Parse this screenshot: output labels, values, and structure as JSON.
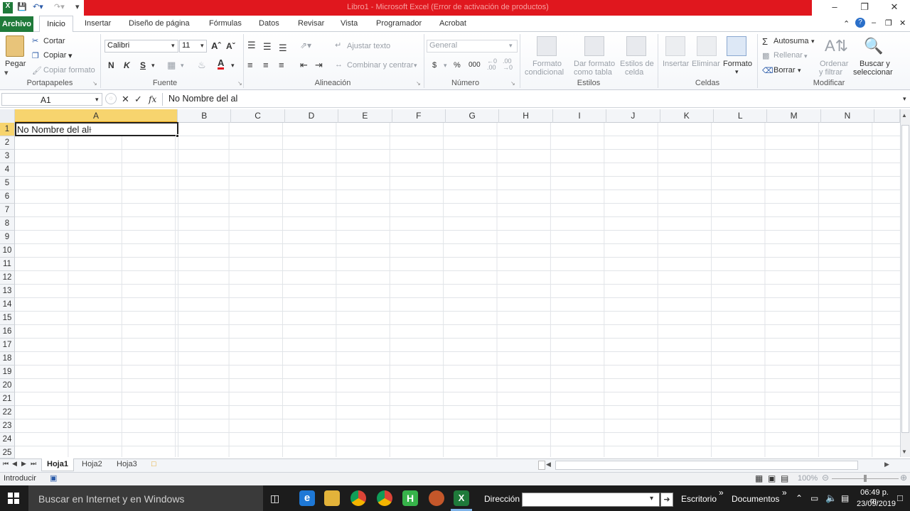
{
  "window": {
    "title": "Libro1 - Microsoft Excel (Error de activación de productos)"
  },
  "tabs": [
    "Archivo",
    "Inicio",
    "Insertar",
    "Diseño de página",
    "Fórmulas",
    "Datos",
    "Revisar",
    "Vista",
    "Programador",
    "Acrobat"
  ],
  "ribbon": {
    "clipboard": {
      "paste": "Pegar",
      "cut": "Cortar",
      "copy": "Copiar",
      "format_painter": "Copiar formato",
      "label": "Portapapeles"
    },
    "font": {
      "name": "Calibri",
      "size": "11",
      "bold": "N",
      "italic": "K",
      "underline": "S",
      "label": "Fuente"
    },
    "alignment": {
      "wrap": "Ajustar texto",
      "merge": "Combinar y centrar",
      "label": "Alineación"
    },
    "number": {
      "format": "General",
      "currency": "$",
      "percent": "%",
      "thousands": "000",
      "label": "Número"
    },
    "styles": {
      "cond_1": "Formato",
      "cond_2": "condicional",
      "table_1": "Dar formato",
      "table_2": "como tabla",
      "cell_1": "Estilos de",
      "cell_2": "celda",
      "label": "Estilos"
    },
    "cells": {
      "insert": "Insertar",
      "delete": "Eliminar",
      "format": "Formato",
      "label": "Celdas"
    },
    "editing": {
      "autosum": "Autosuma",
      "fill": "Rellenar",
      "clear": "Borrar",
      "sort_1": "Ordenar",
      "sort_2": "y filtrar",
      "find_1": "Buscar y",
      "find_2": "seleccionar",
      "label": "Modificar"
    }
  },
  "formula_bar": {
    "name_box": "A1",
    "fx": "fx",
    "content": "No Nombre del al"
  },
  "columns": [
    "A",
    "B",
    "C",
    "D",
    "E",
    "F",
    "G",
    "H",
    "I",
    "J",
    "K",
    "L",
    "M",
    "N"
  ],
  "rows": [
    "1",
    "2",
    "3",
    "4",
    "5",
    "6",
    "7",
    "8",
    "9",
    "10",
    "11",
    "12",
    "13",
    "14",
    "15",
    "16",
    "17",
    "18",
    "19",
    "20",
    "21",
    "22",
    "23",
    "24",
    "25"
  ],
  "active_cell": {
    "ref": "A1",
    "value": "No Nombre del al"
  },
  "sheets": [
    "Hoja1",
    "Hoja2",
    "Hoja3"
  ],
  "status": {
    "mode": "Introducir",
    "zoom": "100%"
  },
  "taskbar": {
    "search_placeholder": "Buscar en Internet y en Windows",
    "address_label": "Dirección",
    "desktop": "Escritorio",
    "documents": "Documentos",
    "time": "06:49 p. m.",
    "date": "23/09/2019"
  }
}
